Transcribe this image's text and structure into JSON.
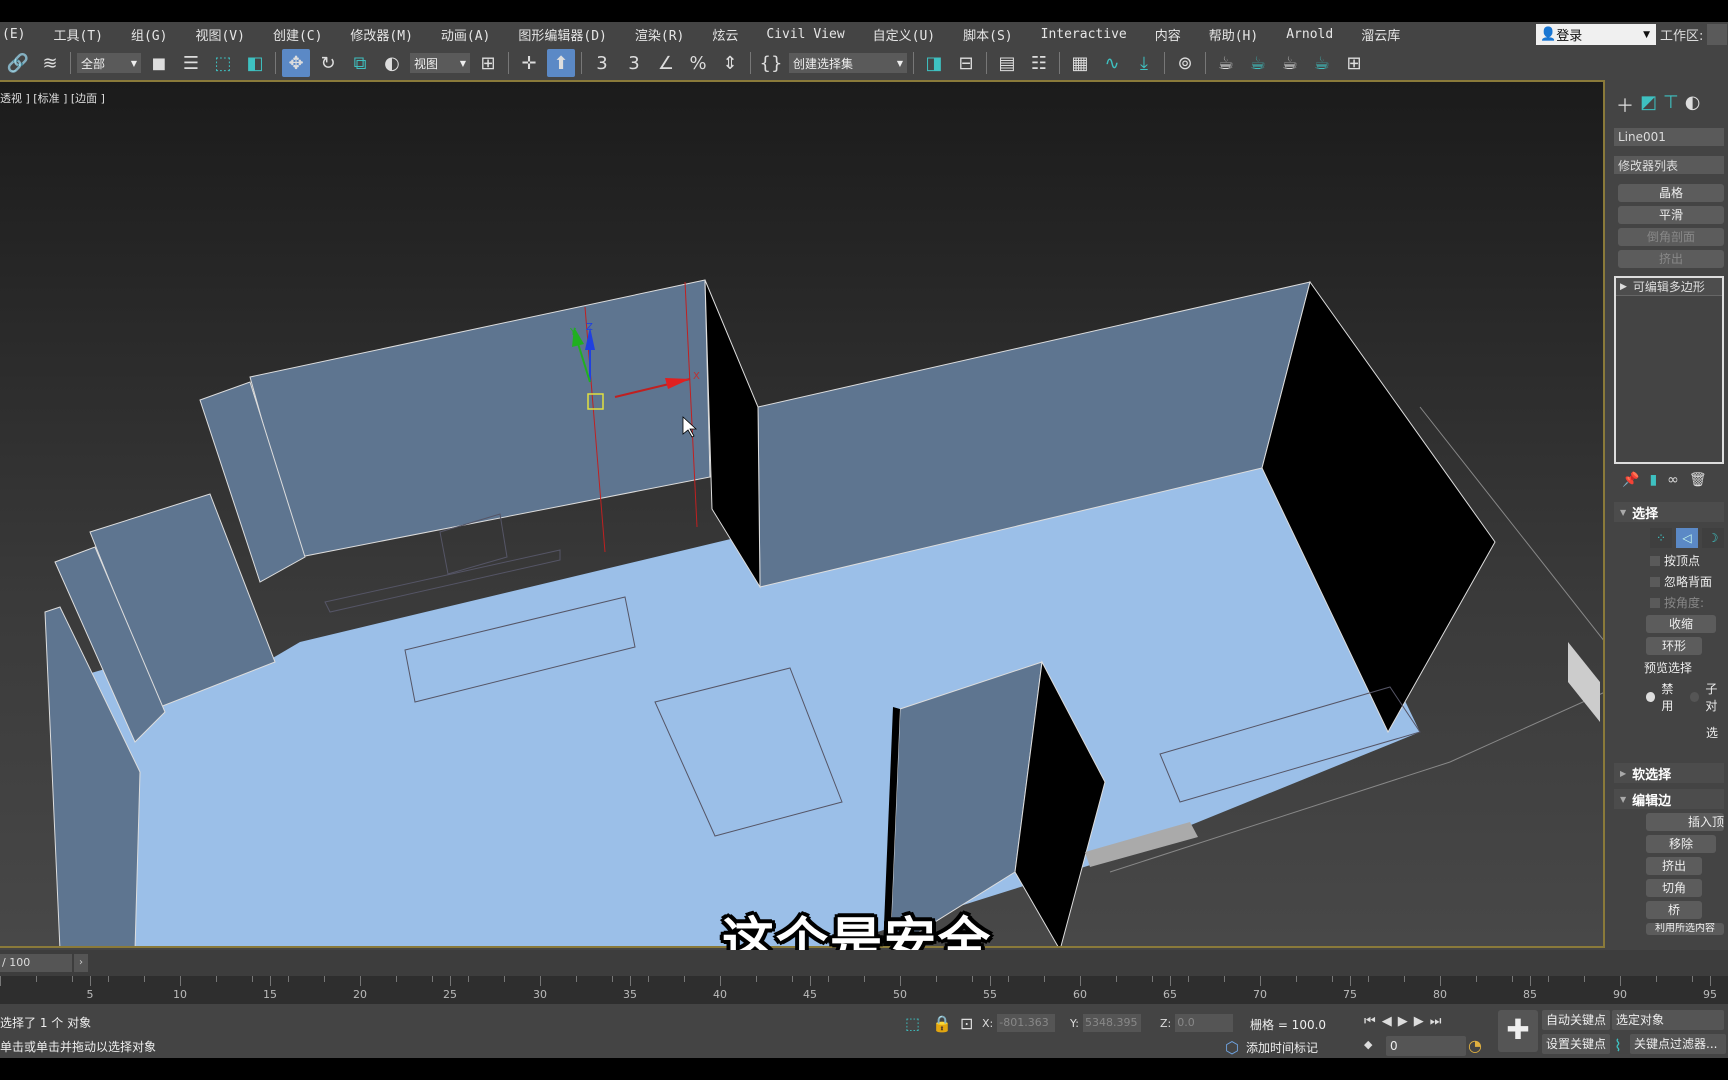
{
  "menubar": {
    "items": [
      "(E)",
      "工具(T)",
      "组(G)",
      "视图(V)",
      "创建(C)",
      "修改器(M)",
      "动画(A)",
      "图形编辑器(D)",
      "渲染(R)",
      "炫云",
      "Civil View",
      "自定义(U)",
      "脚本(S)",
      "Interactive",
      "内容",
      "帮助(H)",
      "Arnold",
      "溜云库"
    ],
    "login_label": "登录",
    "workspace_label": "工作区:"
  },
  "toolbar": {
    "selection_filter": "全部",
    "reference_coord": "视图",
    "named_selection": "创建选择集"
  },
  "viewport": {
    "label": "透视 ] [标准 ] [边面 ]",
    "gizmo_axes": [
      "X",
      "Y",
      "Z"
    ],
    "colors": {
      "wall": "#5e7590",
      "floor": "#9bbfe8",
      "side": "#000000",
      "frame": "#8a7a3a"
    }
  },
  "subtitle": "这个是安全",
  "command_panel": {
    "object_name": "Line001",
    "modifier_list": "修改器列表",
    "buttons": [
      {
        "label": "晶格",
        "enabled": true
      },
      {
        "label": "平滑",
        "enabled": true
      },
      {
        "label": "倒角剖面",
        "enabled": false
      },
      {
        "label": "挤出",
        "enabled": false
      }
    ],
    "stack_item": "可编辑多边形",
    "selection": {
      "title": "选择",
      "by_vertex": "按顶点",
      "ignore_backface": "忽略背面",
      "by_angle": "按角度:",
      "shrink": "收缩",
      "ring": "环形",
      "preview_group": "预览选择",
      "disable": "禁用",
      "subobject": "子对",
      "select_partial": "选"
    },
    "soft_selection": "软选择",
    "edit_edges": {
      "title": "编辑边",
      "insert_vertex": "插入顶",
      "remove": "移除",
      "extrude": "挤出",
      "chamfer": "切角",
      "bridge": "桥",
      "create_shape": "利用所选内容"
    }
  },
  "timeline": {
    "frame_display": "/ 100",
    "ticks": [
      5,
      10,
      15,
      20,
      25,
      30,
      35,
      40,
      45,
      50,
      55,
      60,
      65,
      70,
      75,
      80,
      85,
      90,
      95
    ]
  },
  "status": {
    "selected": "选择了 1 个 对象",
    "prompt": "单击或单击并拖动以选择对象",
    "x": "-801.363",
    "y": "5348.395",
    "z": "0.0",
    "grid": "栅格 = 100.0",
    "add_time_tag": "添加时间标记",
    "frame_value": "0",
    "auto_key": "自动关键点",
    "set_key": "设置关键点",
    "key_target": "选定对象",
    "key_filters": "关键点过滤器..."
  }
}
